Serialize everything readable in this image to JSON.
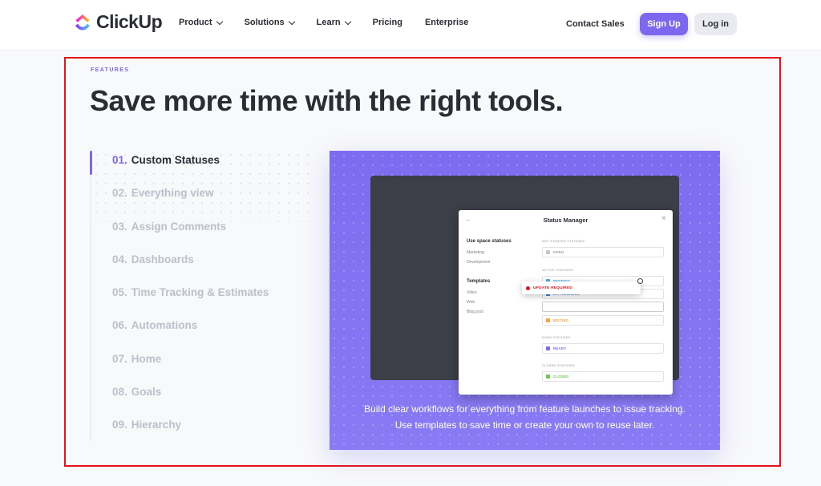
{
  "nav": {
    "logo_text": "ClickUp",
    "menu": [
      "Product",
      "Solutions",
      "Learn",
      "Pricing",
      "Enterprise"
    ],
    "menu_has_dropdown": [
      true,
      true,
      true,
      false,
      false
    ],
    "contact": "Contact Sales",
    "signup": "Sign Up",
    "login": "Log in"
  },
  "section": {
    "eyebrow": "FEATURES",
    "headline": "Save more time with the right tools.",
    "features": [
      {
        "num": "01.",
        "label": "Custom Statuses",
        "active": true
      },
      {
        "num": "02.",
        "label": "Everything view",
        "active": false
      },
      {
        "num": "03.",
        "label": "Assign Comments",
        "active": false
      },
      {
        "num": "04.",
        "label": "Dashboards",
        "active": false
      },
      {
        "num": "05.",
        "label": "Time Tracking & Estimates",
        "active": false
      },
      {
        "num": "06.",
        "label": "Automations",
        "active": false
      },
      {
        "num": "07.",
        "label": "Home",
        "active": false
      },
      {
        "num": "08.",
        "label": "Goals",
        "active": false
      },
      {
        "num": "09.",
        "label": "Hierarchy",
        "active": false
      }
    ],
    "caption_line1": "Build clear workflows for everything from feature launches to issue tracking.",
    "caption_line2": "Use templates to save time or create your own to reuse later."
  },
  "modal": {
    "title": "Status Manager",
    "space_head": "Use space statuses",
    "space_items": [
      "Marketing",
      "Development"
    ],
    "templates_head": "Templates",
    "template_items": [
      "Video",
      "Web",
      "Blog post"
    ],
    "groups": {
      "not_started": "NOT STARTED STATUSES",
      "active": "ACTIVE STATUSES",
      "done": "DONE STATUSES",
      "closed": "CLOSED STATUSES"
    },
    "statuses": {
      "open": "OPEN",
      "pending": "PENDING",
      "in_progress": "IN PROGRESS",
      "editing": "EDITING",
      "ready": "READY",
      "closed": "CLOSED",
      "update": "UPDATE REQUIRED"
    }
  },
  "colors": {
    "accent": "#7b68ee",
    "highlight_border": "#e8121b",
    "open": "#c4c7ce",
    "pending": "#4aa8e0",
    "in_progress": "#3b7ae0",
    "editing": "#f2a33b",
    "ready": "#7b68ee",
    "closed": "#6bc950"
  }
}
